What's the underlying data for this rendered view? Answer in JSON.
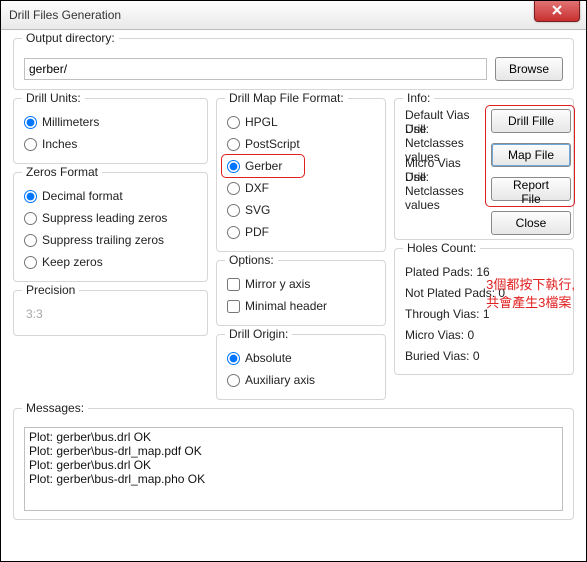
{
  "window": {
    "title": "Drill Files Generation"
  },
  "outdir": {
    "legend": "Output directory:",
    "value": "gerber/",
    "browse": "Browse"
  },
  "units": {
    "legend": "Drill Units:",
    "opts": [
      "Millimeters",
      "Inches"
    ],
    "selected": 0
  },
  "zeros": {
    "legend": "Zeros Format",
    "opts": [
      "Decimal format",
      "Suppress leading zeros",
      "Suppress trailing zeros",
      "Keep zeros"
    ],
    "selected": 0
  },
  "precision": {
    "legend": "Precision",
    "value": "3:3"
  },
  "mapfmt": {
    "legend": "Drill Map File Format:",
    "opts": [
      "HPGL",
      "PostScript",
      "Gerber",
      "DXF",
      "SVG",
      "PDF"
    ],
    "selected": 2
  },
  "options": {
    "legend": "Options:",
    "mirror": "Mirror y axis",
    "minimal": "Minimal header"
  },
  "origin": {
    "legend": "Drill Origin:",
    "opts": [
      "Absolute",
      "Auxiliary axis"
    ],
    "selected": 0
  },
  "info": {
    "legend": "Info:",
    "defvias": "Default Vias Drill:",
    "usenet1": "Use Netclasses values",
    "microvias": "Micro Vias Drill:",
    "usenet2": "Use Netclasses values",
    "holes_legend": "Holes Count:",
    "plated": "Plated Pads: 16",
    "notplated": "Not Plated Pads: 0",
    "through": "Through Vias: 1",
    "micro": "Micro Vias: 0",
    "buried": "Buried Vias: 0"
  },
  "buttons": {
    "drill": "Drill Fille",
    "map": "Map File",
    "report": "Report File",
    "close": "Close"
  },
  "annot": {
    "l1": "3個都按下執行,",
    "l2": "共會產生3檔案"
  },
  "messages": {
    "legend": "Messages:",
    "lines": [
      "Plot: gerber\\bus.drl OK",
      "Plot: gerber\\bus-drl_map.pdf OK",
      "Plot: gerber\\bus.drl OK",
      "Plot: gerber\\bus-drl_map.pho OK"
    ]
  }
}
